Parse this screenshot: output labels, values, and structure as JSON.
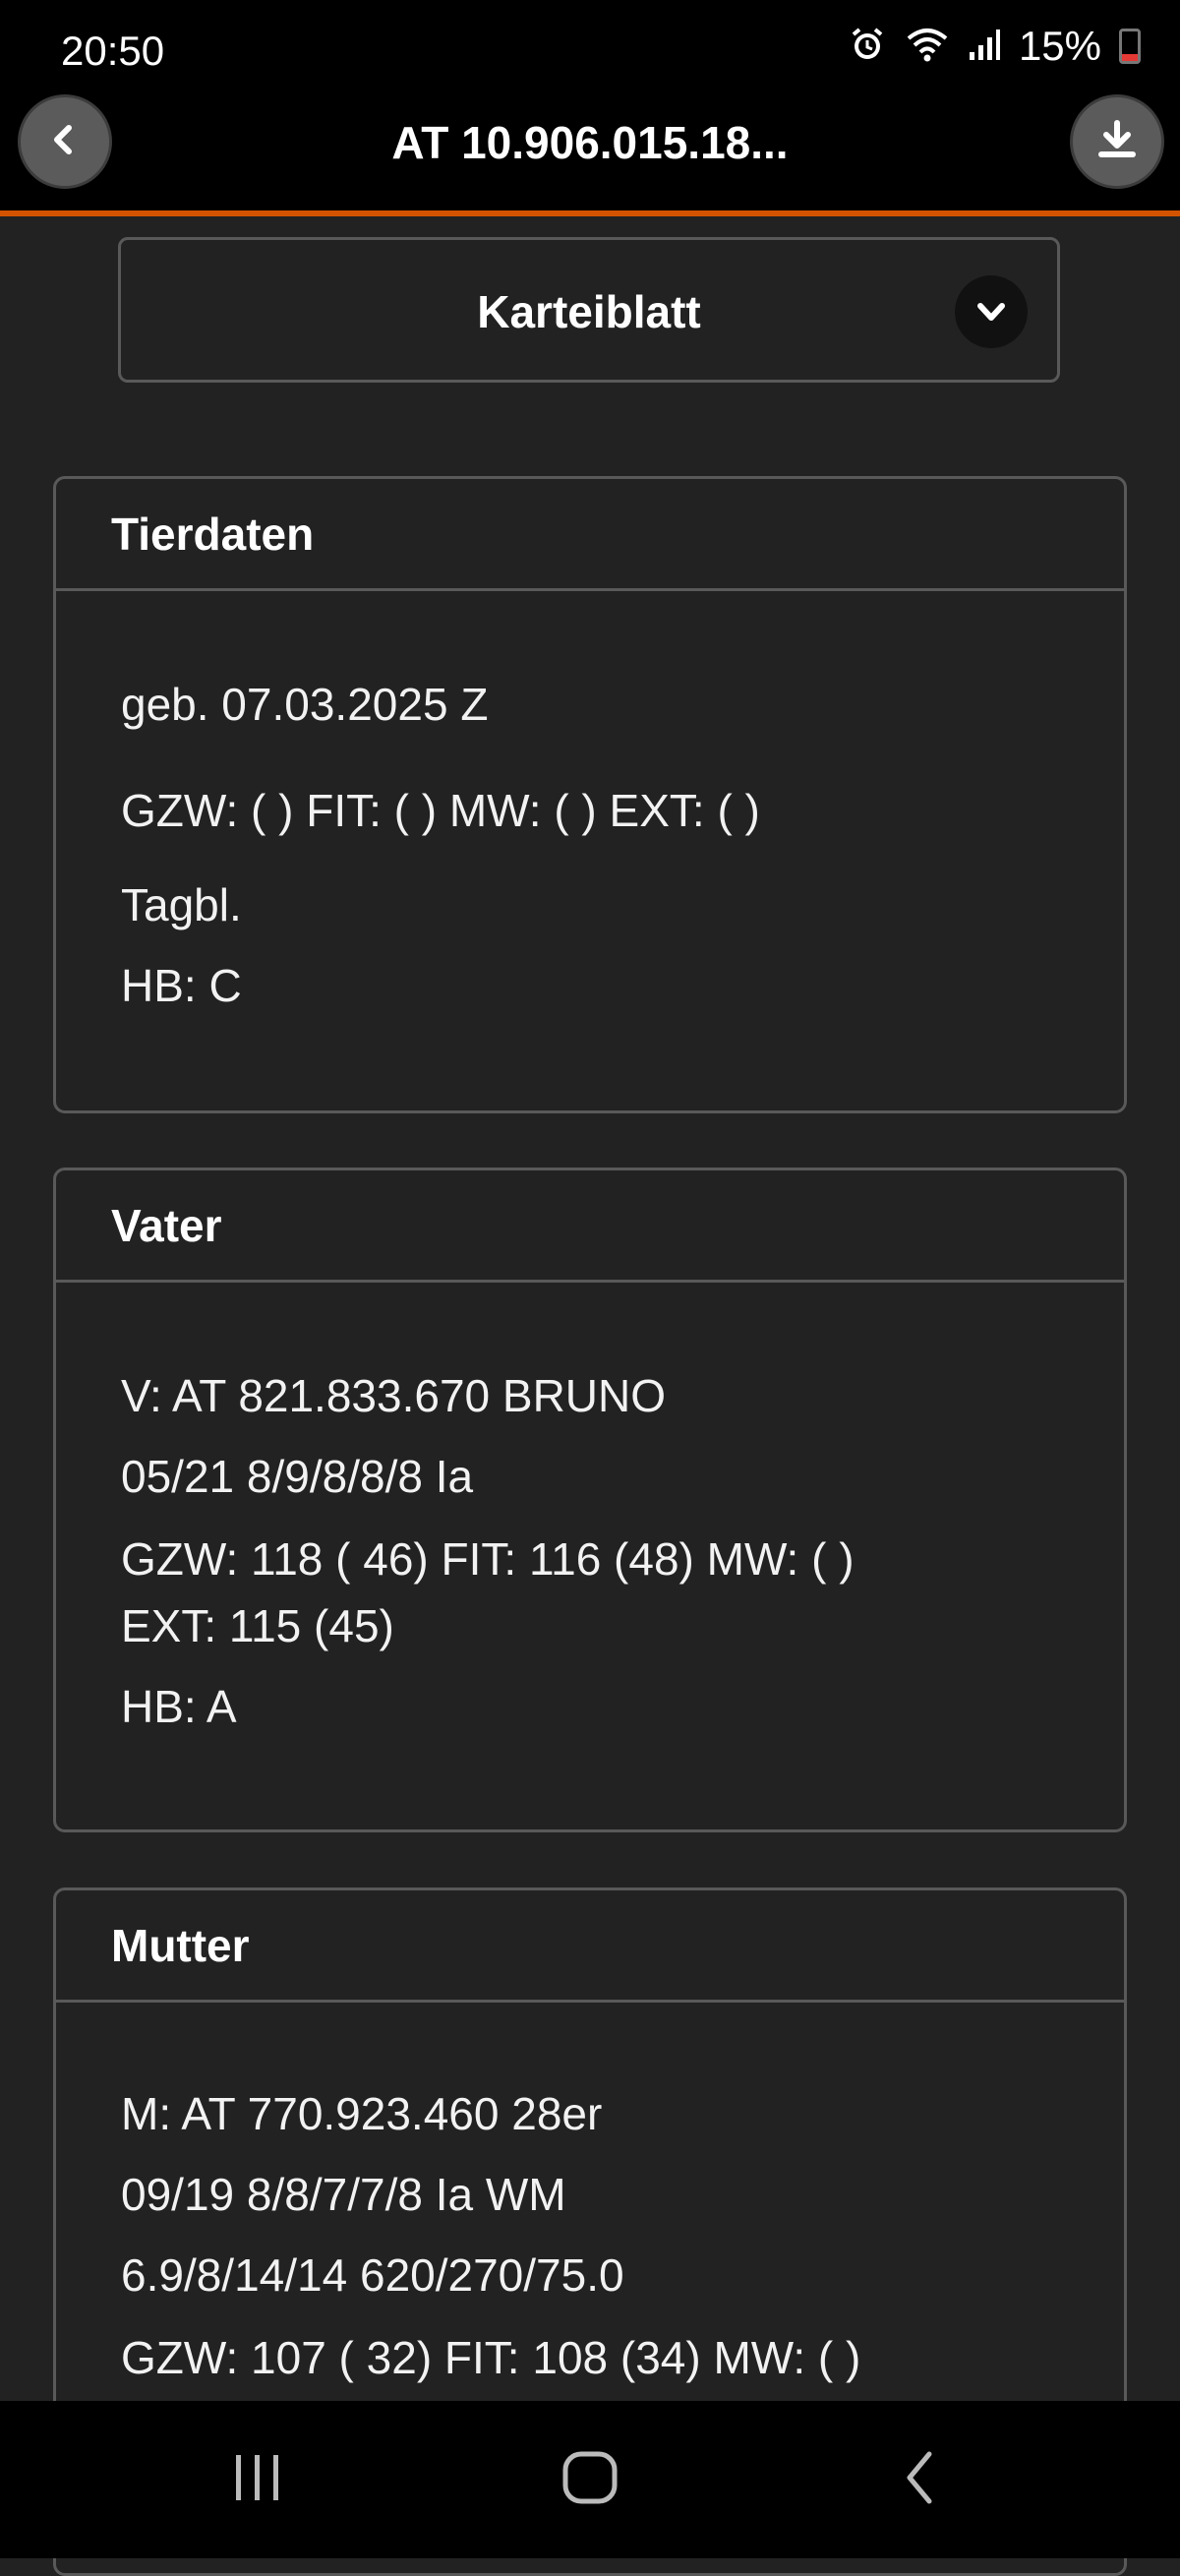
{
  "status_bar": {
    "time": "20:50",
    "battery": "15%",
    "icons": [
      "alarm-icon",
      "wifi-icon",
      "signal-icon",
      "battery-icon"
    ]
  },
  "app_bar": {
    "title": "AT 10.906.015.18...",
    "back_icon": "chevron-left-icon",
    "download_icon": "download-icon",
    "accent_color": "#d35400"
  },
  "view_select": {
    "selected": "Karteiblatt",
    "icon": "chevron-down-icon"
  },
  "cards": {
    "tierdaten": {
      "title": "Tierdaten",
      "lines": [
        "geb. 07.03.2025 Z",
        "GZW: ( ) FIT: ( ) MW: ( ) EXT: ( )",
        "Tagbl.",
        "HB: C"
      ]
    },
    "vater": {
      "title": "Vater",
      "lines": [
        "V: AT 821.833.670 BRUNO",
        "05/21 8/9/8/8/8 Ia",
        "GZW: 118 ( 46) FIT: 116 (48) MW: ( )",
        "EXT: 115 (45)",
        "HB: A"
      ]
    },
    "mutter": {
      "title": "Mutter",
      "lines": [
        "M: AT 770.923.460 28er",
        "09/19 8/8/7/7/8 Ia WM",
        "6.9/8/14/14 620/270/75.0",
        "GZW: 107 ( 32) FIT: 108 (34) MW: ( )"
      ]
    }
  },
  "nav_bar": {
    "recent_icon": "recent-apps-icon",
    "home_icon": "home-icon",
    "back_icon": "back-icon"
  }
}
